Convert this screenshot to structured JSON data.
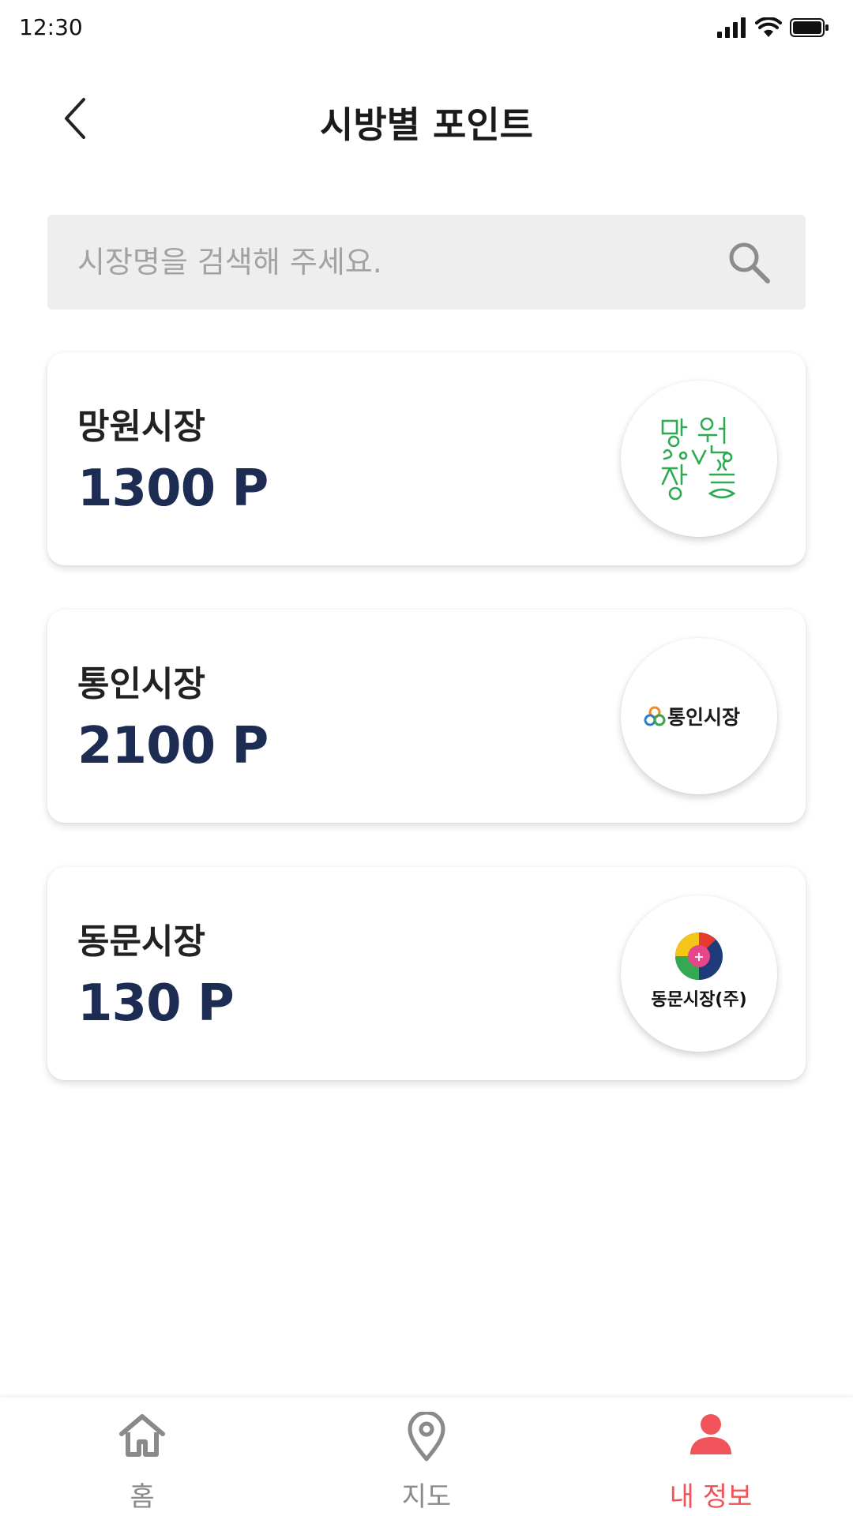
{
  "status_bar": {
    "time": "12:30"
  },
  "header": {
    "title": "시방별 포인트"
  },
  "search": {
    "placeholder": "시장명을 검색해 주세요."
  },
  "markets": [
    {
      "name": "망원시장",
      "points": "1300 P",
      "logo": "mangwon-market-logo"
    },
    {
      "name": "통인시장",
      "points": "2100 P",
      "logo": "tongin-market-logo",
      "logo_text": "통인시장"
    },
    {
      "name": "동문시장",
      "points": "130 P",
      "logo": "dongmun-market-logo",
      "logo_text": "동문시장(주)"
    }
  ],
  "bottom_nav": {
    "items": [
      {
        "label": "홈",
        "icon": "home-icon",
        "active": false
      },
      {
        "label": "지도",
        "icon": "map-pin-icon",
        "active": false
      },
      {
        "label": "내 정보",
        "icon": "person-icon",
        "active": true
      }
    ]
  },
  "colors": {
    "points": "#1c2c52",
    "active_nav": "#f0545a",
    "inactive_nav": "#8a8a8a",
    "search_bg": "#eeeeee",
    "mangwon_logo": "#2eaa52"
  }
}
